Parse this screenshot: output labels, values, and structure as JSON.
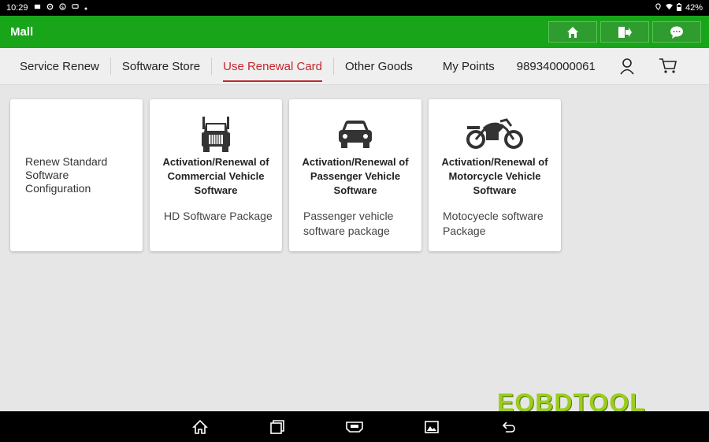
{
  "status": {
    "time": "10:29",
    "battery": "42%"
  },
  "appbar": {
    "title": "Mall"
  },
  "tabs": [
    {
      "label": "Service Renew"
    },
    {
      "label": "Software Store"
    },
    {
      "label": "Use Renewal Card",
      "active": true
    },
    {
      "label": "Other Goods"
    }
  ],
  "header_right": {
    "points_label": "My Points",
    "account_number": "989340000061"
  },
  "cards": [
    {
      "title": "Renew Standard Software Configuration",
      "icon": "none"
    },
    {
      "title": "Activation/Renewal of Commercial Vehicle Software",
      "desc": "HD Software Package",
      "icon": "truck-icon"
    },
    {
      "title": "Activation/Renewal of Passenger Vehicle Software",
      "desc": "Passenger vehicle software package",
      "icon": "car-icon"
    },
    {
      "title": "Activation/Renewal of Motorcycle Vehicle Software",
      "desc": "Motocyecle software Package",
      "icon": "motorcycle-icon"
    }
  ],
  "watermark": "EOBDTOOL",
  "colors": {
    "appbar": "#19a519",
    "active_tab": "#c4252b",
    "background": "#e6e6e6"
  }
}
